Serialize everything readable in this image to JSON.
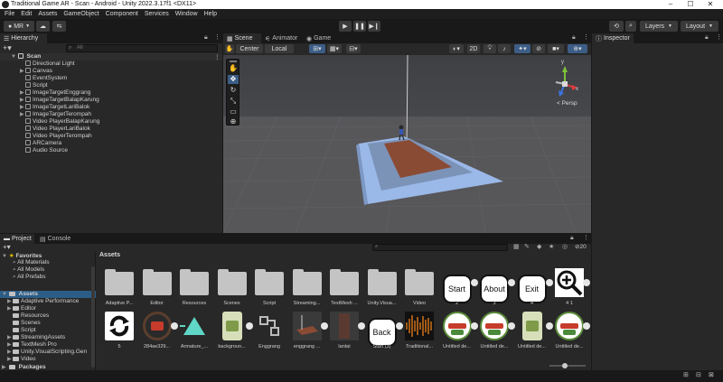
{
  "window": {
    "title": "Traditional Game AR - Scan - Android - Unity 2022.3.17f1 <DX11>"
  },
  "menu": [
    "File",
    "Edit",
    "Assets",
    "GameObject",
    "Component",
    "Services",
    "Window",
    "Help"
  ],
  "toolbar": {
    "account": "MR",
    "layers": "Layers",
    "layout": "Layout"
  },
  "hierarchy": {
    "tab": "Hierarchy",
    "search_placeholder": "All",
    "scene": "Scan",
    "items": [
      "Directional Light",
      "Canvas",
      "EventSystem",
      "Script",
      "ImageTargetEnggrang",
      "ImageTargetBalapKarung",
      "ImageTargetLariBalok",
      "ImageTargetTerompah",
      "Video PlayerBalapKarung",
      "Video PlayerLariBalok",
      "Video PlayerTerompah",
      "ARCamera",
      "Audio Source"
    ]
  },
  "scene": {
    "tabs": [
      "Scene",
      "Animator",
      "Game"
    ],
    "pivot": "Center",
    "space": "Local",
    "mode_2d": "2D",
    "persp": "< Persp",
    "gizmo_axes": {
      "y": "y",
      "x": "x"
    }
  },
  "inspector": {
    "tab": "Inspector"
  },
  "project": {
    "tabs": [
      "Project",
      "Console"
    ],
    "breadcrumb": "Assets",
    "hidden_count": "20",
    "favorites": {
      "label": "Favorites",
      "items": [
        "All Materials",
        "All Models",
        "All Prefabs"
      ]
    },
    "assets_root": "Assets",
    "tree": [
      "Adaptive Performance",
      "Editor",
      "Resources",
      "Scenes",
      "Script",
      "StreamingAssets",
      "TextMesh Pro",
      "Unity.VisualScripting.Gen",
      "Video"
    ],
    "packages": "Packages",
    "row1": [
      {
        "label": "Adaptive P...",
        "kind": "folder"
      },
      {
        "label": "Editor",
        "kind": "folder"
      },
      {
        "label": "Resources",
        "kind": "folder"
      },
      {
        "label": "Scenes",
        "kind": "folder"
      },
      {
        "label": "Script",
        "kind": "folder"
      },
      {
        "label": "Streaming...",
        "kind": "folder"
      },
      {
        "label": "TextMesh ...",
        "kind": "folder"
      },
      {
        "label": "Unity.Visua...",
        "kind": "folder"
      },
      {
        "label": "Video",
        "kind": "folder"
      },
      {
        "label": "2",
        "kind": "pill",
        "text": "Start"
      },
      {
        "label": "3",
        "kind": "pill",
        "text": "About"
      },
      {
        "label": "4",
        "kind": "pill",
        "text": "Exit"
      },
      {
        "label": "4 1",
        "kind": "zoom"
      }
    ],
    "row2": [
      {
        "label": "5",
        "kind": "refresh"
      },
      {
        "label": "284ae329...",
        "kind": "badge"
      },
      {
        "label": "Armature_...",
        "kind": "triangle"
      },
      {
        "label": "backgroun...",
        "kind": "card"
      },
      {
        "label": "Enggrang",
        "kind": "graph"
      },
      {
        "label": "enggrang ...",
        "kind": "model"
      },
      {
        "label": "lantai",
        "kind": "dark"
      },
      {
        "label": "Start (3)",
        "kind": "pill",
        "text": "Back"
      },
      {
        "label": "Traditional...",
        "kind": "audio"
      },
      {
        "label": "Untitled de...",
        "kind": "logo"
      },
      {
        "label": "Untitled de...",
        "kind": "logo"
      },
      {
        "label": "Untitled de...",
        "kind": "card"
      },
      {
        "label": "Untitled de...",
        "kind": "logo"
      }
    ]
  },
  "colors": {
    "selection": "#2c5d87",
    "panel": "#282828",
    "sky": "#4a4b4f",
    "ground": "#575659",
    "platform": "#8aa8d8",
    "mat": "#8a4b34"
  }
}
